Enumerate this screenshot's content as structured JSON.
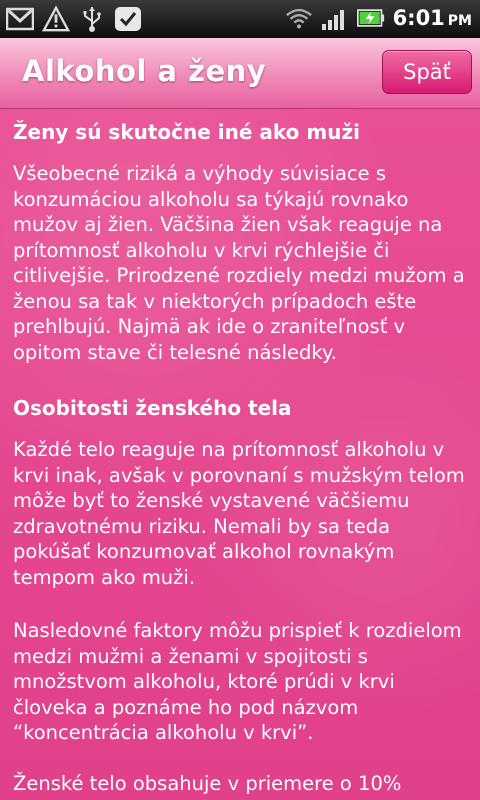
{
  "statusbar": {
    "time": "6:01",
    "ampm": "PM"
  },
  "header": {
    "title": "Alkohol a ženy",
    "back_label": "Späť"
  },
  "sections": [
    {
      "heading": "Ženy sú skutočne iné ako muži",
      "paragraphs": [
        "Všeobecné riziká a výhody súvisiace s konzumáciou alkoholu sa týkajú rovnako mužov aj žien. Väčšina žien však reaguje na prítomnosť alkoholu v krvi rýchlejšie či citlivejšie. Prirodzené rozdiely medzi mužom a ženou sa tak v niektorých prípadoch ešte prehlbujú. Najmä ak ide o zraniteľnosť v opitom stave či telesné následky."
      ]
    },
    {
      "heading": "Osobitosti ženského tela",
      "paragraphs": [
        "Každé telo reaguje na prítomnosť alkoholu v krvi inak, avšak v porovnaní s mužským telom môže byť to ženské vystavené väčšiemu zdravotnému riziku. Nemali by sa teda pokúšať konzumovať alkohol rovnakým tempom ako muži.",
        "Nasledovné faktory môžu prispieť k rozdielom medzi mužmi a ženami v spojitosti s množstvom alkoholu, ktoré prúdi v krvi človeka a poznáme ho pod názvom “koncentrácia alkoholu v krvi”.",
        "Ženské telo obsahuje v priemere o 10%"
      ]
    }
  ]
}
